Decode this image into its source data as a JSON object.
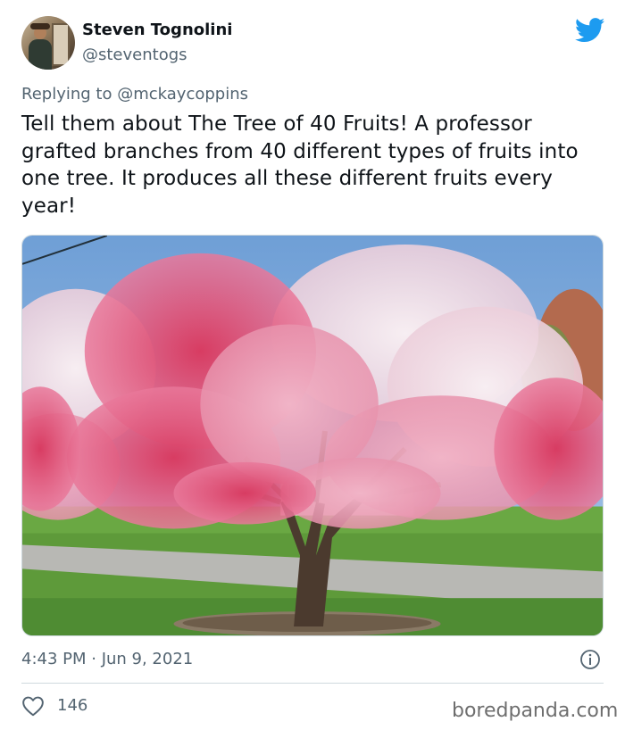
{
  "author": {
    "display_name": "Steven Tognolini",
    "handle": "@steventogs"
  },
  "reply": {
    "prefix": "Replying to",
    "mention": "@mckaycoppins"
  },
  "tweet": {
    "text": "Tell them about The Tree of 40 Fruits! A professor grafted branches from 40 different types of fruits into one tree. It produces all these different fruits every year!"
  },
  "meta": {
    "timestamp": "4:43 PM · Jun 9, 2021"
  },
  "engagement": {
    "likes": "146"
  },
  "watermark": "boredpanda.com",
  "icons": {
    "brand": "twitter-bird-icon",
    "info": "info-icon",
    "like": "heart-icon"
  },
  "colors": {
    "twitter_blue": "#1d9bf0",
    "secondary_text": "#536471",
    "primary_text": "#0f1419",
    "divider": "#cfd9de"
  }
}
